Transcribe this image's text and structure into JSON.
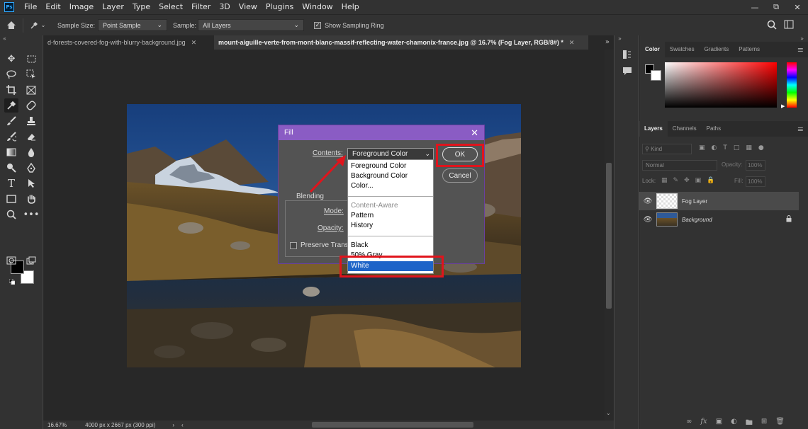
{
  "menubar": {
    "logo": "Ps",
    "items": [
      "File",
      "Edit",
      "Image",
      "Layer",
      "Type",
      "Select",
      "Filter",
      "3D",
      "View",
      "Plugins",
      "Window",
      "Help"
    ]
  },
  "options": {
    "sample_size_label": "Sample Size:",
    "sample_size_value": "Point Sample",
    "sample_label": "Sample:",
    "sample_value": "All Layers",
    "sampling_ring_label": "Show Sampling Ring"
  },
  "tabs": [
    {
      "label": "d-forests-covered-fog-with-blurry-background.jpg",
      "active": false
    },
    {
      "label": "mount-aiguille-verte-from-mont-blanc-massif-reflecting-water-chamonix-france.jpg @ 16.7% (Fog Layer, RGB/8#) *",
      "active": true
    }
  ],
  "status": {
    "zoom": "16.67%",
    "doc_info": "4000 px x 2667 px (300 ppi)"
  },
  "color_panel": {
    "tabs": [
      "Color",
      "Swatches",
      "Gradients",
      "Patterns"
    ]
  },
  "layers_panel": {
    "tabs": [
      "Layers",
      "Channels",
      "Paths"
    ],
    "filter_kind": "Kind",
    "blend_mode": "Normal",
    "opacity_label": "Opacity:",
    "opacity_value": "100%",
    "lock_label": "Lock:",
    "fill_label": "Fill:",
    "fill_value": "100%",
    "layers": [
      {
        "name": "Fog Layer",
        "selected": true
      },
      {
        "name": "Background",
        "selected": false
      }
    ]
  },
  "fill_dialog": {
    "title": "Fill",
    "contents_label": "Contents:",
    "contents_value": "Foreground Color",
    "ok_label": "OK",
    "cancel_label": "Cancel",
    "blending_label": "Blending",
    "mode_label": "Mode:",
    "opacity_label": "Opacity:",
    "preserve_label": "Preserve Trans",
    "dropdown_options": [
      "Foreground Color",
      "Background Color",
      "Color...",
      "Content-Aware",
      "Pattern",
      "History",
      "Black",
      "50% Gray",
      "White"
    ],
    "selected_option": "White"
  },
  "colors": {
    "accent_purple": "#8a5cc4",
    "highlight_red": "#e0141c",
    "selection_blue": "#1e64c8"
  }
}
